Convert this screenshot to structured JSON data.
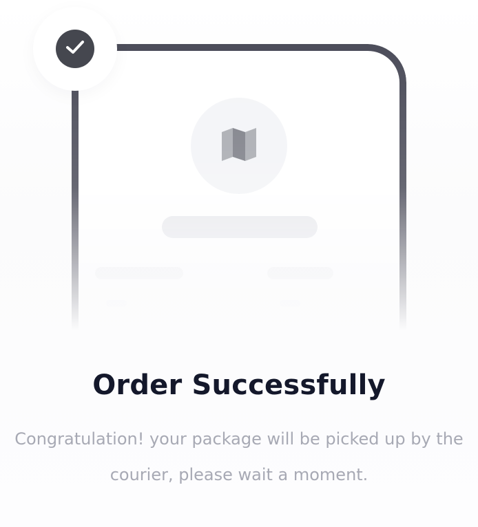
{
  "illustration": {
    "check_icon": "check-icon",
    "map_icon": "map-icon",
    "colors": {
      "phone_frame": "#4c4d5a",
      "badge": "#45474f",
      "map_circle": "#f3f4f7",
      "map_fold_dark": "#8e9097",
      "map_fold_light": "#b7b9bf"
    }
  },
  "content": {
    "title": "Order Successfully",
    "message": "Congratulation! your package will be picked up by the courier, please wait a moment."
  },
  "colors": {
    "title": "#14182b",
    "message": "#a7a9b4"
  }
}
